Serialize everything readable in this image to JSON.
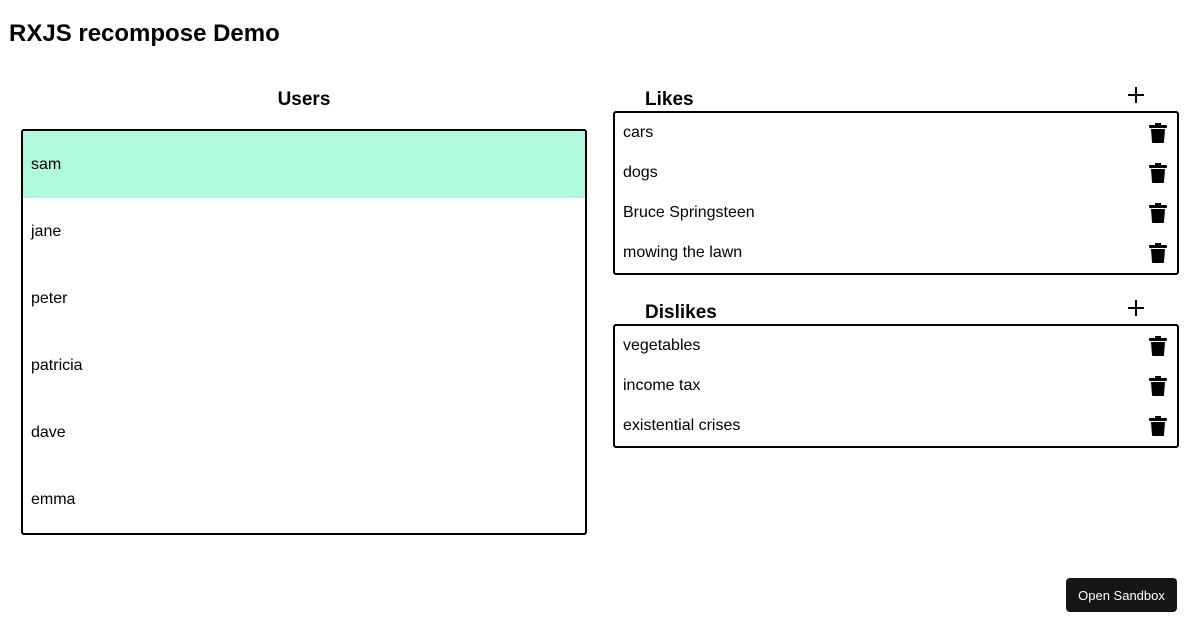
{
  "app": {
    "title": "RXJS recompose Demo"
  },
  "users": {
    "heading": "Users",
    "selected_color": "#b1f9dd",
    "items": [
      {
        "label": "sam",
        "selected": true
      },
      {
        "label": "jane",
        "selected": false
      },
      {
        "label": "peter",
        "selected": false
      },
      {
        "label": "patricia",
        "selected": false
      },
      {
        "label": "dave",
        "selected": false
      },
      {
        "label": "emma",
        "selected": false
      }
    ]
  },
  "likes": {
    "heading": "Likes",
    "add_icon": "plus-icon",
    "delete_icon": "trash-icon",
    "items": [
      "cars",
      "dogs",
      "Bruce Springsteen",
      "mowing the lawn"
    ]
  },
  "dislikes": {
    "heading": "Dislikes",
    "add_icon": "plus-icon",
    "delete_icon": "trash-icon",
    "items": [
      "vegetables",
      "income tax",
      "existential crises"
    ]
  },
  "footer": {
    "sandbox_button_label": "Open Sandbox",
    "sandbox_button_color": "#151515"
  }
}
